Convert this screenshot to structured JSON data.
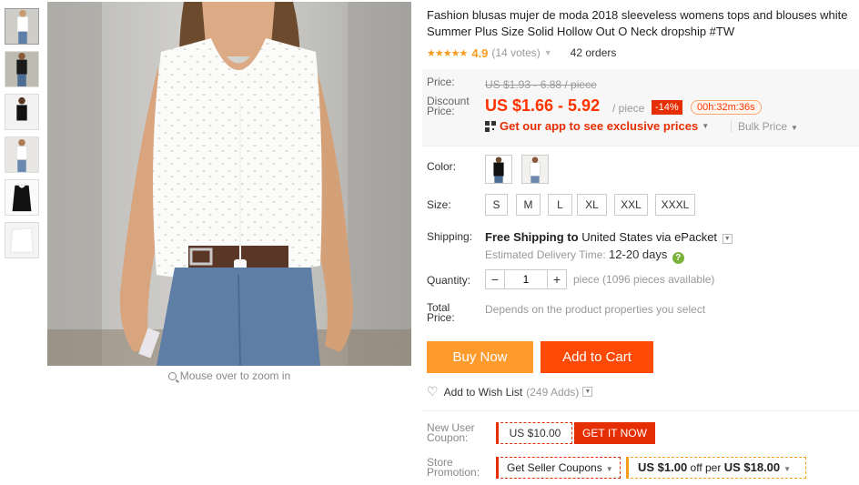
{
  "product": {
    "title": "Fashion blusas mujer de moda 2018 sleeveless womens tops and blouses white Summer Plus Size Solid Hollow Out O Neck dropship #TW",
    "rating": {
      "stars": "★★★★★",
      "score": "4.9",
      "votes": "(14 votes)",
      "orders": "42 orders"
    }
  },
  "gallery": {
    "thumbnails": [
      "white top",
      "black top",
      "black top back",
      "white top side",
      "black top flat",
      "white top flat"
    ],
    "zoom_hint": "Mouse over to zoom in"
  },
  "price": {
    "label": "Price:",
    "original": "US $1.93 - 6.88 / piece",
    "discount_label": "Discount Price:",
    "current": "US $1.66 - 5.92",
    "unit": "/ piece",
    "discount_badge": "-14%",
    "timer": "00h:32m:36s",
    "app_promo": "Get our app to see exclusive prices",
    "bulk": "Bulk Price"
  },
  "options": {
    "color_label": "Color:",
    "size_label": "Size:",
    "sizes": [
      "S",
      "M",
      "L",
      "XL",
      "XXL",
      "XXXL"
    ]
  },
  "shipping": {
    "label": "Shipping:",
    "free": "Free Shipping to",
    "destination": "United States via ePacket",
    "estimated_label": "Estimated Delivery Time:",
    "estimated_value": "12-20 days"
  },
  "quantity": {
    "label": "Quantity:",
    "value": "1",
    "minus": "−",
    "plus": "+",
    "note": "piece (1096 pieces available)"
  },
  "total": {
    "label": "Total Price:",
    "value": "Depends on the product properties you select"
  },
  "actions": {
    "buy_now": "Buy Now",
    "add_to_cart": "Add to Cart",
    "wishlist": "Add to Wish List",
    "wishlist_count": "(249 Adds)"
  },
  "coupons": {
    "new_user_label": "New User Coupon:",
    "new_user_amount": "US $10.00",
    "get_it_now": "GET IT NOW",
    "store_label": "Store Promotion:",
    "seller_coupons": "Get Seller Coupons",
    "promo_off": "US $1.00",
    "promo_mid": "off per",
    "promo_threshold": "US $18.00"
  },
  "colors": {
    "accent_red": "#e62e04",
    "buy_orange": "#ff9a2c",
    "cart_orange": "#ff4a05",
    "star_orange": "#f79d1e",
    "help_green": "#7bb33a"
  }
}
